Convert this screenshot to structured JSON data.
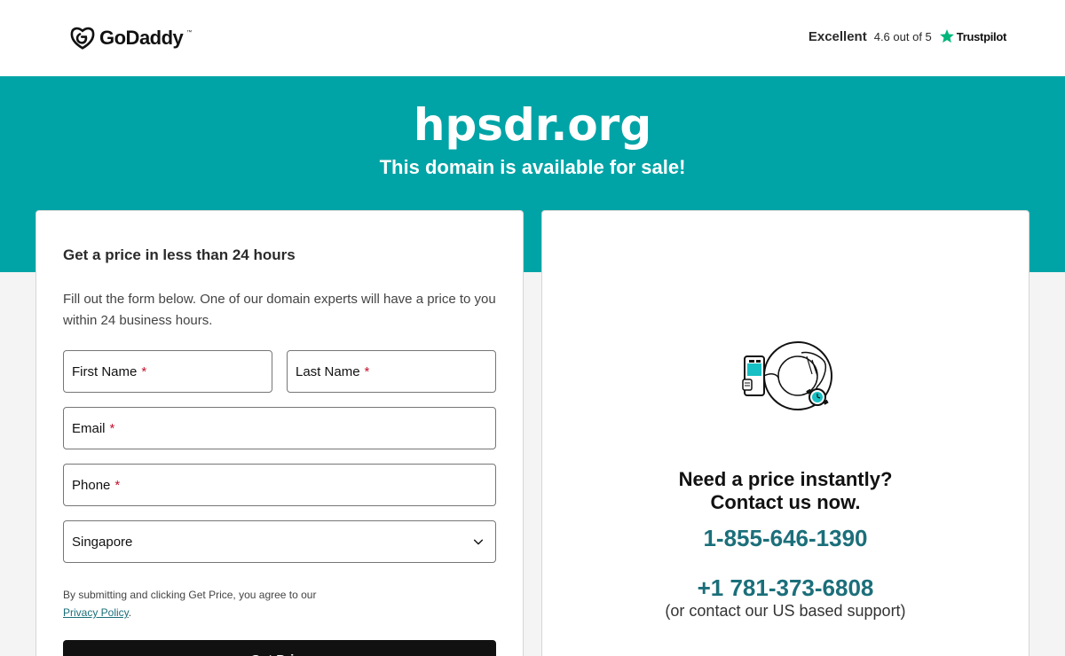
{
  "header": {
    "brand": "GoDaddy",
    "trustpilot": {
      "rating_word": "Excellent",
      "score_text": "4.6 out of 5",
      "brand": "Trustpilot",
      "star_color": "#00b67a"
    }
  },
  "hero": {
    "domain": "hpsdr.org",
    "subtitle": "This domain is available for sale!",
    "background": "#00a4a6"
  },
  "form": {
    "title": "Get a price in less than 24 hours",
    "description": "Fill out the form below. One of our domain experts will have a price to you within 24 business hours.",
    "first_name_placeholder": "First Name",
    "last_name_placeholder": "Last Name",
    "email_placeholder": "Email",
    "phone_placeholder": "Phone",
    "required_mark": "*",
    "country_selected": "Singapore",
    "terms_text": "By submitting and clicking Get Price, you agree to our",
    "privacy_link": "Privacy Policy",
    "terms_end": ".",
    "submit_label": "Get Price"
  },
  "contact": {
    "heading_line1": "Need a price instantly?",
    "heading_line2": "Contact us now.",
    "phone_primary": "1-855-646-1390",
    "phone_secondary": "+1 781-373-6808",
    "support_note": "(or contact our US based support)",
    "accent_color": "#1b6f7a"
  }
}
